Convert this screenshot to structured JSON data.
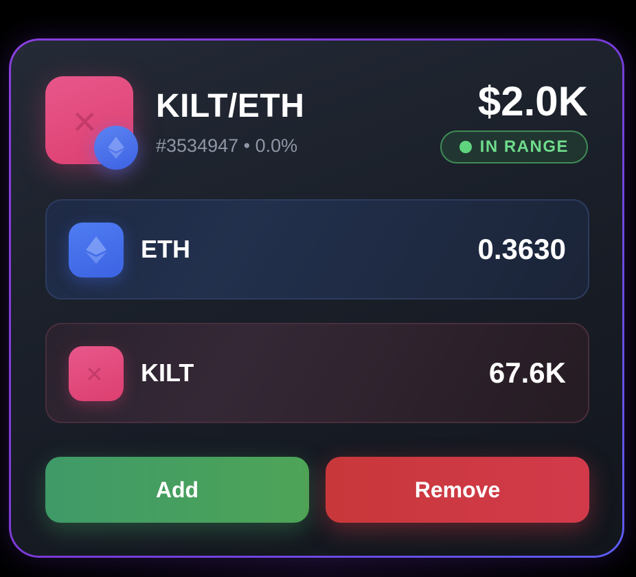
{
  "position": {
    "pair": "KILT/ETH",
    "token_id": "#3534947",
    "separator": "•",
    "fee": "0.0%",
    "value": "$2.0K",
    "status": "IN RANGE"
  },
  "tokens": [
    {
      "symbol": "ETH",
      "amount": "0.3630",
      "icon": "ethereum-icon",
      "color": "#4f7cf2"
    },
    {
      "symbol": "KILT",
      "amount": "67.6K",
      "icon": "kilt-icon",
      "color": "#e8578a"
    }
  ],
  "actions": {
    "add_label": "Add",
    "remove_label": "Remove"
  },
  "colors": {
    "accent_border": "#8a3fe0",
    "in_range": "#6fdc8c",
    "add": "#4ea457",
    "remove": "#d23a4b"
  }
}
